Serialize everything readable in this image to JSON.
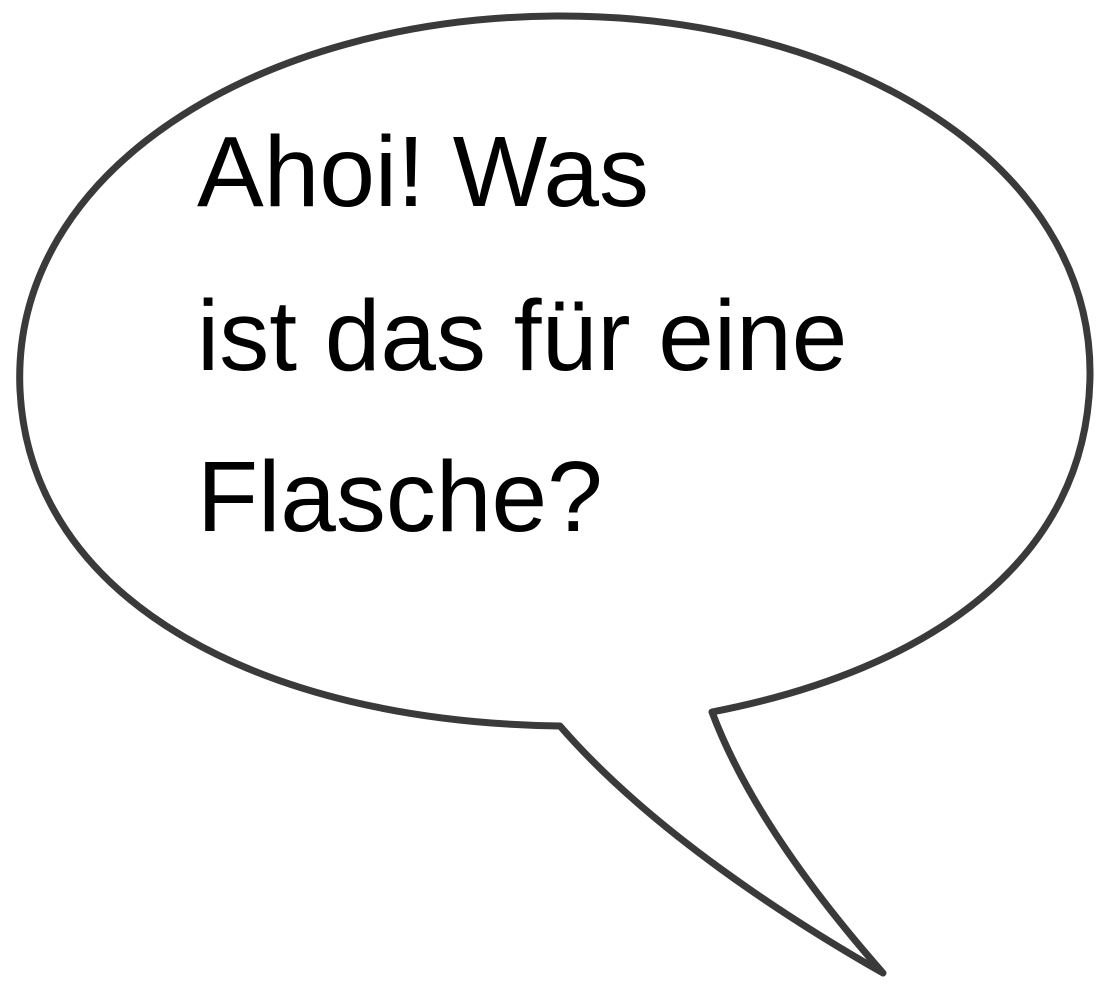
{
  "speech_bubble": {
    "lines": [
      "Ahoi! Was",
      "ist das für eine",
      "Flasche?"
    ],
    "outline_color": "#3a3a3a",
    "fill_color": "#ffffff",
    "text_color": "#000000"
  }
}
